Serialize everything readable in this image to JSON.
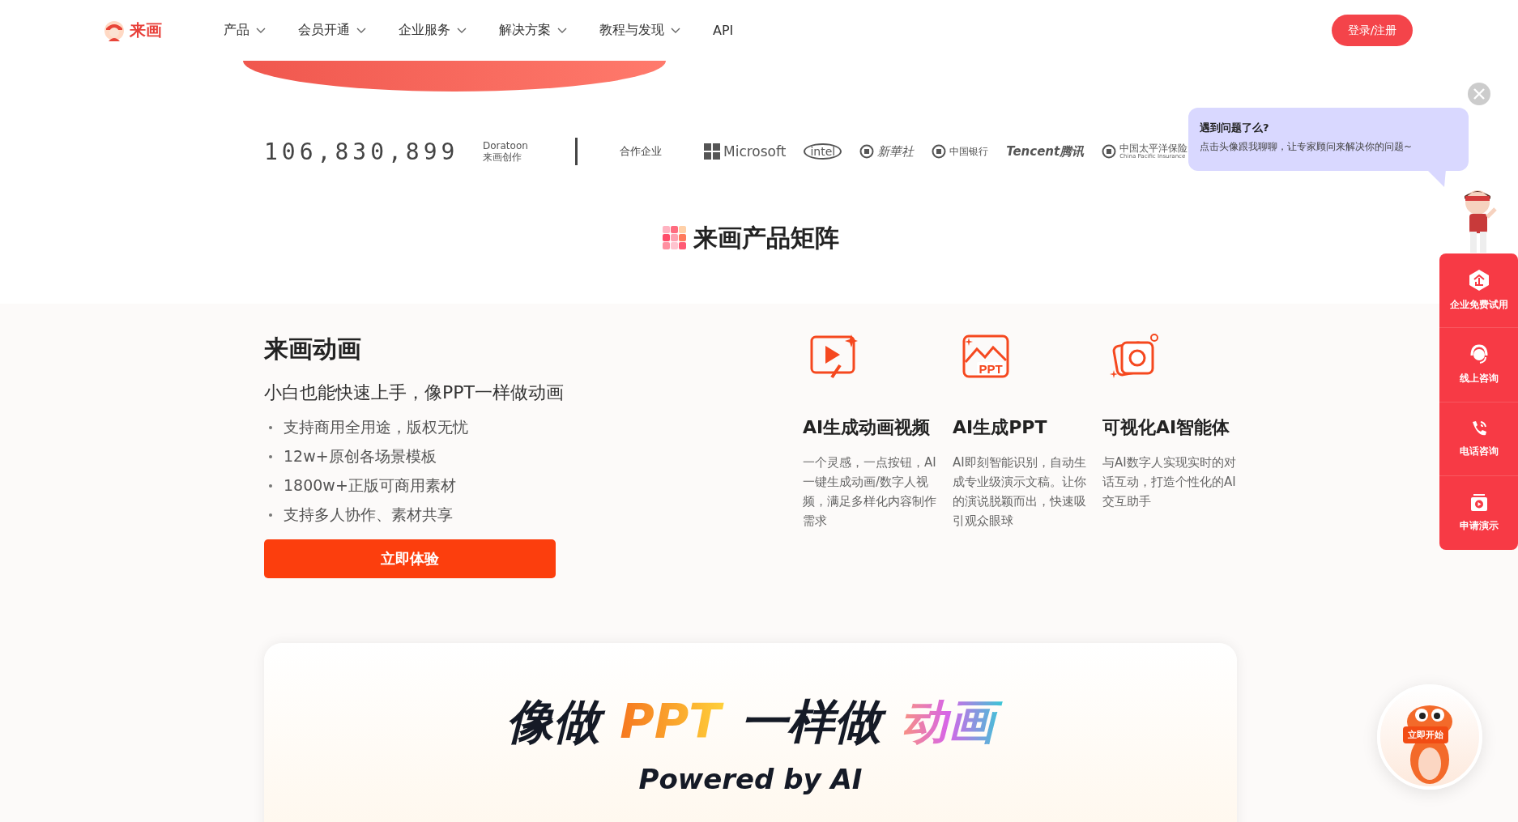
{
  "header": {
    "brand": "来画",
    "nav": [
      {
        "label": "产品",
        "dropdown": true
      },
      {
        "label": "会员开通",
        "dropdown": true
      },
      {
        "label": "企业服务",
        "dropdown": true
      },
      {
        "label": "解决方案",
        "dropdown": true
      },
      {
        "label": "教程与发现",
        "dropdown": true
      },
      {
        "label": "API",
        "dropdown": false
      }
    ],
    "login": "登录/注册"
  },
  "stats": {
    "count": "106,830,899",
    "brand_en": "Doratoon",
    "brand_cn": "来画创作",
    "partners_label": "合作企业",
    "partners": [
      {
        "kind": "microsoft",
        "name": "Microsoft"
      },
      {
        "kind": "intel",
        "name": "intel"
      },
      {
        "kind": "xinhua",
        "name": "新華社"
      },
      {
        "kind": "boc",
        "name": "中国银行"
      },
      {
        "kind": "tencent",
        "name": "Tencent腾讯"
      },
      {
        "kind": "cpic",
        "name": "中国太平洋保险",
        "sub": "China Pacific Insurance"
      }
    ]
  },
  "section_title": "来画产品矩阵",
  "product": {
    "title": "来画动画",
    "subtitle": "小白也能快速上手，像PPT一样做动画",
    "bullets": [
      "支持商用全用途，版权无忧",
      "12w+原创各场景模板",
      "1800w+正版可商用素材",
      "支持多人协作、素材共享"
    ],
    "cta": "立即体验",
    "features": [
      {
        "title": "AI生成动画视频",
        "desc": "一个灵感，一点按钮，AI一键生成动画/数字人视频，满足多样化内容制作需求"
      },
      {
        "title": "AI生成PPT",
        "icon_label": "PPT",
        "desc": "AI即刻智能识别，自动生成专业级演示文稿。让你的演说脱颖而出，快速吸引观众眼球"
      },
      {
        "title": "可视化AI智能体",
        "desc": "与AI数字人实现实时的对话互动，打造个性化的AI交互助手"
      }
    ]
  },
  "banner": {
    "headline": [
      {
        "text": "像做",
        "kind": "plain"
      },
      {
        "text": "PPT",
        "kind": "warm"
      },
      {
        "text": "一样做",
        "kind": "plain"
      },
      {
        "text": "动画",
        "kind": "rainbow"
      }
    ],
    "tagline": "Powered by AI"
  },
  "chat_bubble": {
    "title": "遇到问题了么?",
    "text": "点击头像跟我聊聊，让专家顾问来解决你的问题~"
  },
  "side_menu": [
    "企业免费试用",
    "线上咨询",
    "电话咨询",
    "申请演示"
  ],
  "float_button": "立即开始"
}
